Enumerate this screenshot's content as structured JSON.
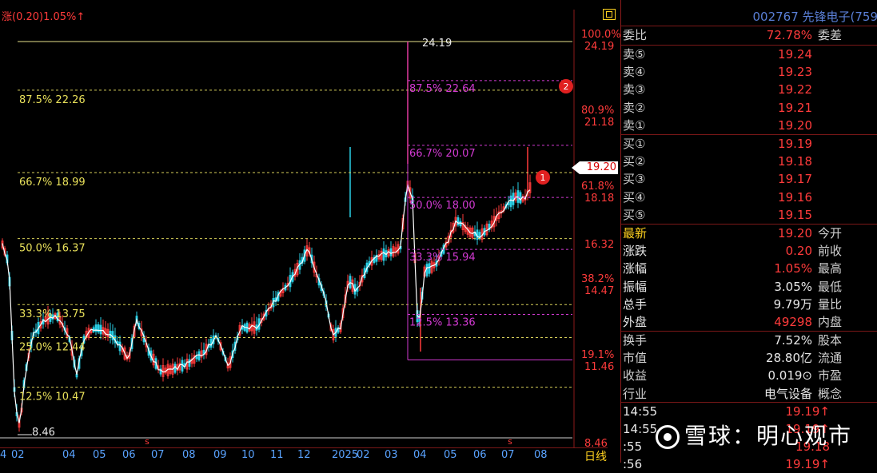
{
  "header": {
    "change_label": "涨(0.20)1.05%↑"
  },
  "stock": {
    "code_name": "002767 先锋电子(759"
  },
  "axis": {
    "right_labels": [
      {
        "pct": "100.0%",
        "price": "24.19",
        "color": "#ff3b3b"
      },
      {
        "pct": "80.9%",
        "price": "21.18",
        "color": "#ff3b3b"
      },
      {
        "pct": "61.8%",
        "price": "18.18",
        "color": "#ff3b3b"
      },
      {
        "pct": "",
        "price": "16.32",
        "color": "#ff3b3b"
      },
      {
        "pct": "38.2%",
        "price": "14.47",
        "color": "#ff3b3b"
      },
      {
        "pct": "19.1%",
        "price": "11.46",
        "color": "#ff3b3b"
      },
      {
        "pct": "",
        "price": "8.46",
        "color": "#ff3b3b"
      }
    ],
    "current_price_tag": "19.20",
    "months": [
      "4",
      "02",
      "04",
      "05",
      "06",
      "07",
      "08",
      "09",
      "10",
      "11",
      "12",
      "2025",
      "02",
      "03",
      "04",
      "05",
      "06",
      "07",
      "08"
    ],
    "period": "日线"
  },
  "fib_left": [
    {
      "label": "87.5% 22.26"
    },
    {
      "label": "66.7% 18.99"
    },
    {
      "label": "50.0% 16.37"
    },
    {
      "label": "33.3% 13.75"
    },
    {
      "label": "25.0% 12.44"
    },
    {
      "label": "12.5% 10.47"
    }
  ],
  "fib_right": [
    {
      "label": "87.5% 22.64"
    },
    {
      "label": "66.7% 20.07"
    },
    {
      "label": "50.0% 18.00"
    },
    {
      "label": "33.3% 15.94"
    },
    {
      "label": "12.5% 13.36"
    }
  ],
  "chart_labels": {
    "high": "24.19",
    "low": "8.46",
    "marker1": "1",
    "marker2": "2",
    "s_markers": [
      "s",
      "s"
    ]
  },
  "panel": {
    "ratio": {
      "label": "委比",
      "value": "72.78%",
      "label2": "委差"
    },
    "asks": [
      {
        "label": "卖⑤",
        "value": "19.24"
      },
      {
        "label": "卖④",
        "value": "19.23"
      },
      {
        "label": "卖③",
        "value": "19.22"
      },
      {
        "label": "卖②",
        "value": "19.21"
      },
      {
        "label": "卖①",
        "value": "19.20"
      }
    ],
    "bids": [
      {
        "label": "买①",
        "value": "19.19"
      },
      {
        "label": "买②",
        "value": "19.18"
      },
      {
        "label": "买③",
        "value": "19.17"
      },
      {
        "label": "买④",
        "value": "19.16"
      },
      {
        "label": "买⑤",
        "value": "19.15"
      }
    ],
    "quote": [
      {
        "label": "最新",
        "value": "19.20",
        "label2": "今开",
        "cls": "red",
        "lcls": "ylw"
      },
      {
        "label": "涨跌",
        "value": "0.20",
        "label2": "前收",
        "cls": "red",
        "lcls": "wht"
      },
      {
        "label": "涨幅",
        "value": "1.05%",
        "label2": "最高",
        "cls": "red",
        "lcls": "wht"
      },
      {
        "label": "振幅",
        "value": "3.05%",
        "label2": "最低",
        "cls": "wht",
        "lcls": "wht"
      },
      {
        "label": "总手",
        "value": "9.79万",
        "label2": "量比",
        "cls": "wht",
        "lcls": "wht"
      },
      {
        "label": "外盘",
        "value": "49298",
        "label2": "内盘",
        "cls": "red",
        "lcls": "wht"
      }
    ],
    "fundamentals": [
      {
        "label": "换手",
        "value": "7.52%",
        "label2": "股本",
        "cls": "wht"
      },
      {
        "label": "市值",
        "value": "28.80亿",
        "label2": "流通",
        "cls": "wht"
      },
      {
        "label": "收益",
        "value": "0.019⊙",
        "label2": "市盈",
        "cls": "wht"
      },
      {
        "label": "行业",
        "value": "电气设备",
        "label2": "概念",
        "cls": "wht"
      }
    ],
    "ticks": [
      {
        "time": "14:55",
        "price": "19.19↑"
      },
      {
        "time": "14:55",
        "price": "19.19↑"
      },
      {
        "time": ":55",
        "price": "19.18"
      },
      {
        "time": ":56",
        "price": "19.19↑"
      }
    ]
  },
  "watermark": "雪球：明心观市"
}
